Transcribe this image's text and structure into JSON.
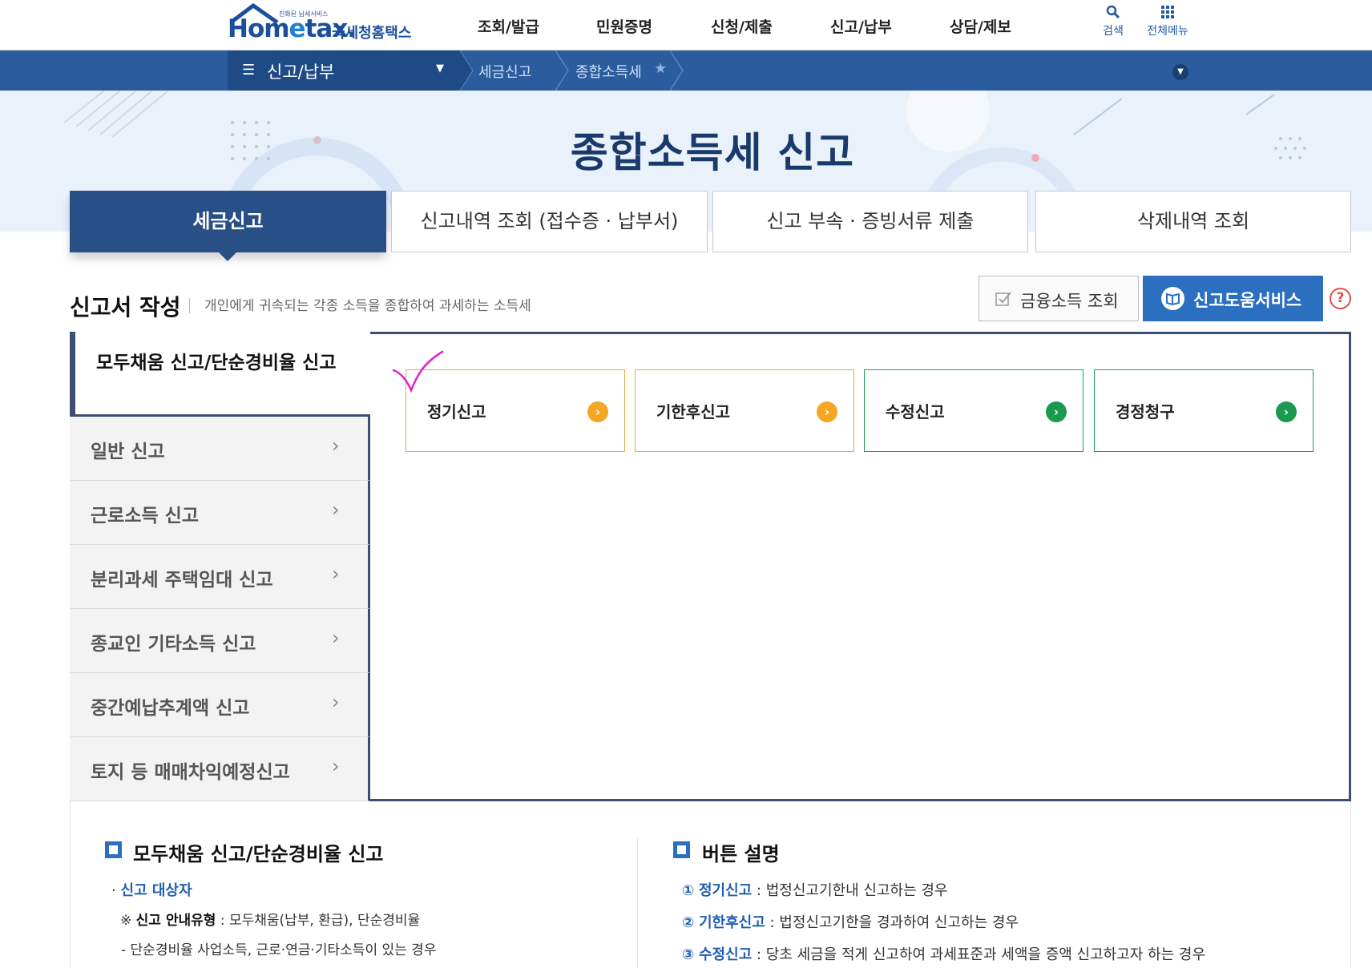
{
  "logo": {
    "tagline": "진화된 납세서비스",
    "brand_home": "Hom",
    "brand_e": "e",
    "brand_tax": "tax.",
    "brand_kr": "국세청홈택스"
  },
  "gnb": [
    "조회/발급",
    "민원증명",
    "신청/제출",
    "신고/납부",
    "상담/제보"
  ],
  "util": {
    "search": "검색",
    "all_menu": "전체메뉴"
  },
  "breadcrumb": {
    "menu": "신고/납부",
    "items": [
      "세금신고",
      "종합소득세"
    ]
  },
  "page_title": "종합소득세 신고",
  "tabs": [
    "세금신고",
    "신고내역 조회 (접수증 · 납부서)",
    "신고 부속 · 증빙서류 제출",
    "삭제내역 조회"
  ],
  "section": {
    "title": "신고서 작성",
    "desc": "개인에게 귀속되는 각종 소득을 종합하여 과세하는 소득세",
    "btn_financial": "금융소득 조회",
    "btn_help": "신고도움서비스",
    "help_q": "?"
  },
  "left_menu": {
    "active": "모두채움 신고/단순경비율 신고",
    "items": [
      "일반 신고",
      "근로소득 신고",
      "분리과세 주택임대 신고",
      "종교인 기타소득 신고",
      "중간예납추계액 신고",
      "토지 등 매매차익예정신고"
    ]
  },
  "options": [
    {
      "label": "정기신고",
      "color": "#f5a623"
    },
    {
      "label": "기한후신고",
      "color": "#f5a623"
    },
    {
      "label": "수정신고",
      "color": "#1a9a4e"
    },
    {
      "label": "경정청구",
      "color": "#1a9a4e"
    }
  ],
  "info_left": {
    "heading": "모두채움 신고/단순경비율 신고",
    "target_label": "신고 대상자",
    "guide_label": "신고 안내유형",
    "guide_text": " : 모두채움(납부, 환급), 단순경비율",
    "note": "단순경비율 사업소득, 근로·연금·기타소득이 있는 경우"
  },
  "info_right": {
    "heading": "버튼 설명",
    "items": [
      {
        "num": "①",
        "term": "정기신고",
        "desc": " : 법정신고기한내 신고하는 경우"
      },
      {
        "num": "②",
        "term": "기한후신고",
        "desc": " : 법정신고기한을 경과하여 신고하는 경우"
      },
      {
        "num": "③",
        "term": "수정신고",
        "desc": " : 당초 세금을 적게 신고하여 과세표준과 세액을 증액 신고하고자 하는 경우"
      }
    ]
  }
}
